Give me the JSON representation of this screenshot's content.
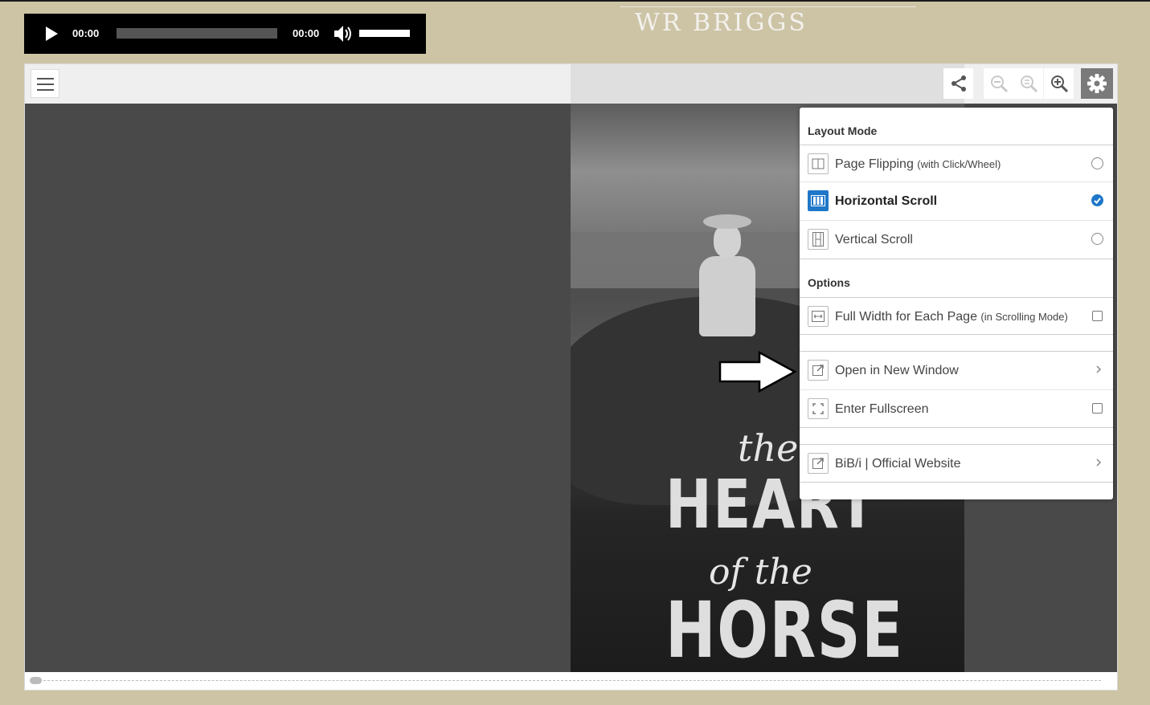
{
  "audio": {
    "current_time": "00:00",
    "duration": "00:00",
    "progress": 0,
    "volume": 1.0
  },
  "book": {
    "author": "WR BRIGGS",
    "title_the": "the",
    "title_heart": "HEART",
    "title_of_the": "of the",
    "title_horse": "HORSE"
  },
  "menu": {
    "layout_title": "Layout Mode",
    "options_title": "Options",
    "page_flipping": "Page Flipping",
    "page_flipping_note": "(with Click/Wheel)",
    "horizontal_scroll": "Horizontal Scroll",
    "vertical_scroll": "Vertical Scroll",
    "full_width": "Full Width for Each Page",
    "full_width_note": "(in Scrolling Mode)",
    "open_new_window": "Open in New Window",
    "enter_fullscreen": "Enter Fullscreen",
    "official_website": "BiB/i | Official Website",
    "selected_layout": "horizontal"
  },
  "colors": {
    "background": "#cdc4a6",
    "accent": "#1e77c8",
    "viewer": "#494949"
  },
  "icons": {
    "play": "play-icon",
    "mute": "volume-icon",
    "share": "share-icon",
    "zoom_out": "zoom-out-icon",
    "zoom_reset": "zoom-reset-icon",
    "zoom_in": "zoom-in-icon",
    "settings": "gear-icon"
  }
}
